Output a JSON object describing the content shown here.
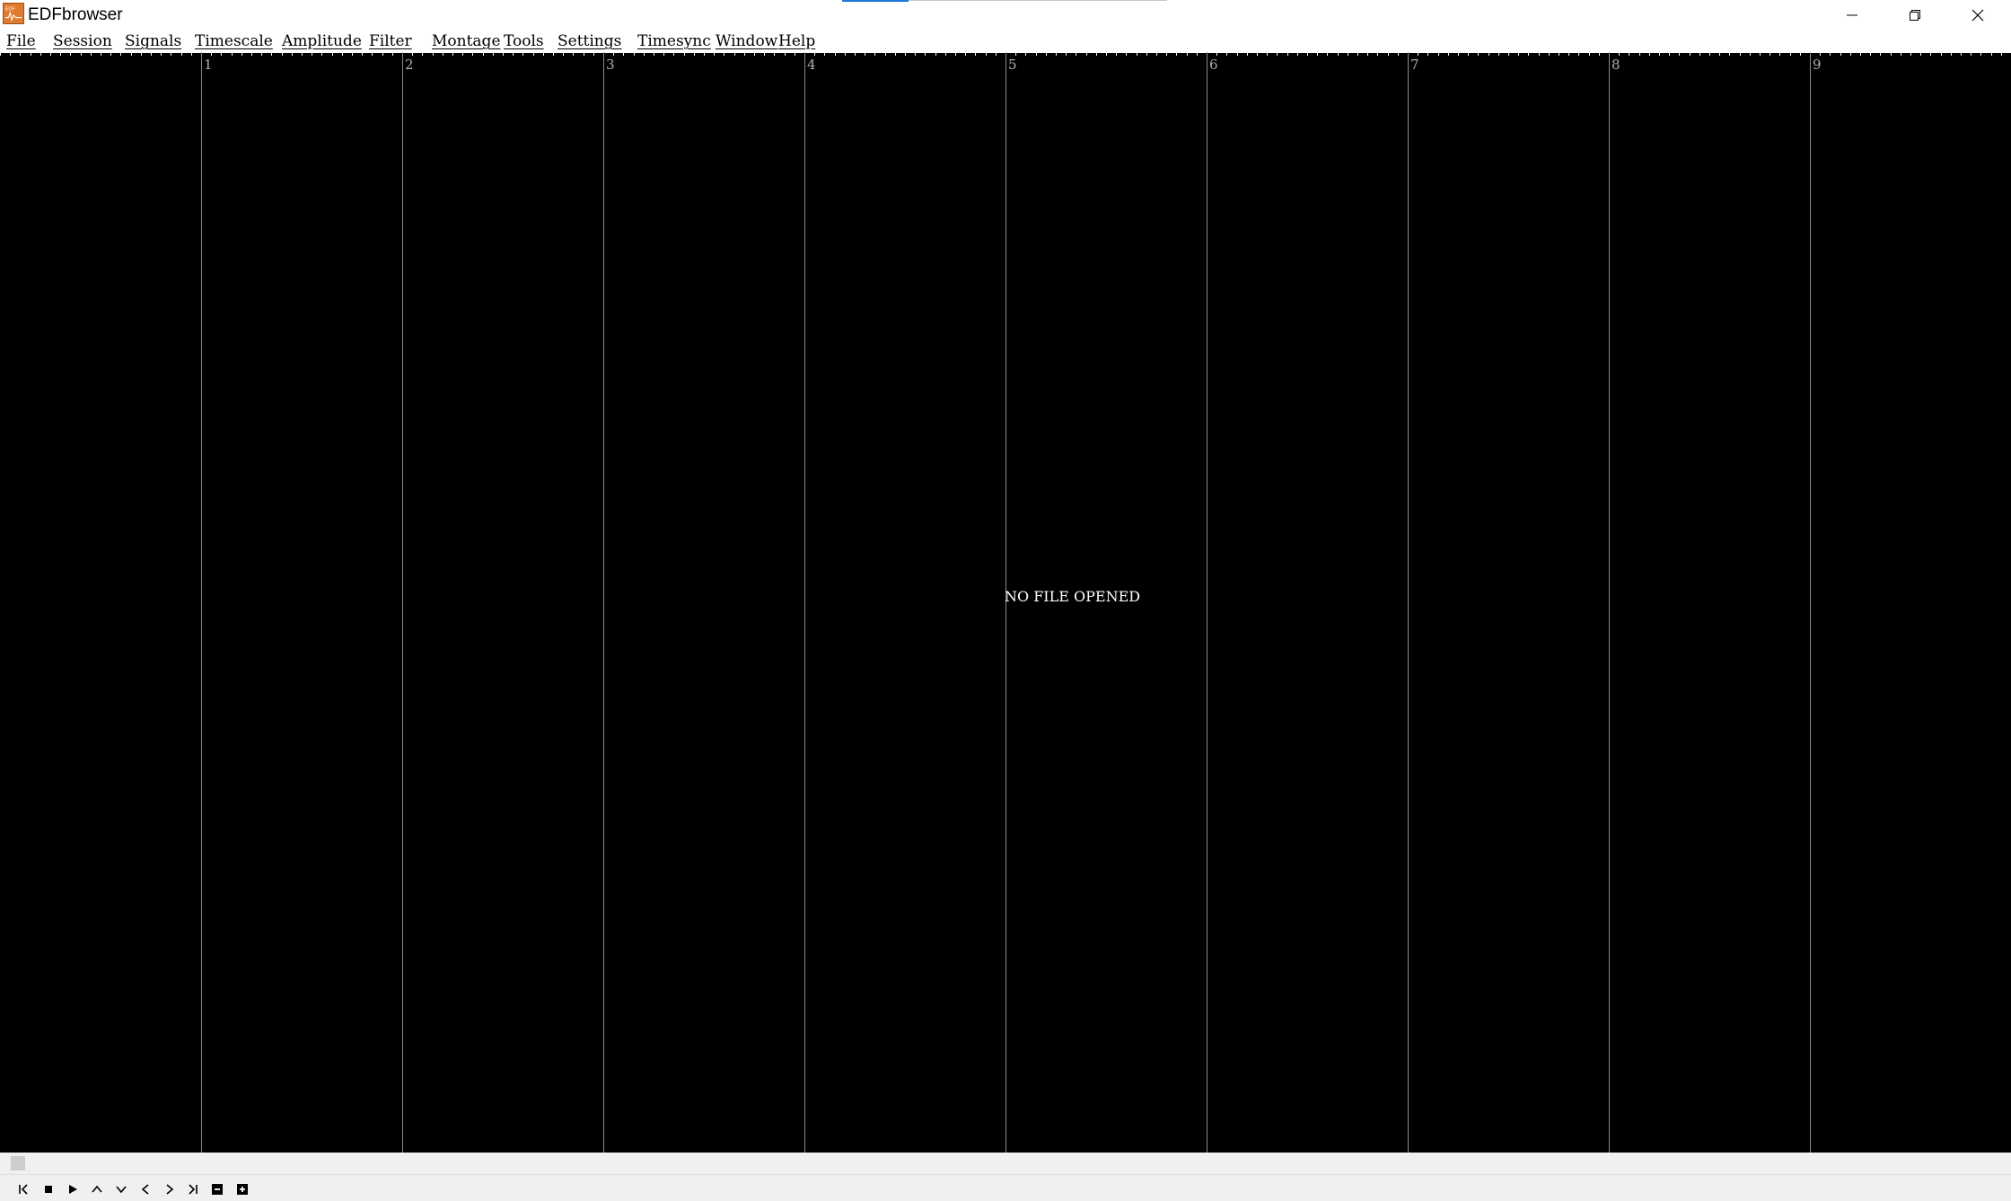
{
  "window": {
    "title": "EDFbrowser",
    "icons": {
      "app": "edfbrowser-logo-icon",
      "minimize": "minimize-icon",
      "restore": "restore-icon",
      "close": "close-icon"
    },
    "accent_color": "#1e78d7"
  },
  "menubar": {
    "items": [
      {
        "label": "File"
      },
      {
        "label": "Session"
      },
      {
        "label": "Signals"
      },
      {
        "label": "Timescale"
      },
      {
        "label": "Amplitude"
      },
      {
        "label": "Filter"
      },
      {
        "label": "Montage"
      },
      {
        "label": "Tools"
      },
      {
        "label": "Settings"
      },
      {
        "label": "Timesync"
      },
      {
        "label": "Window"
      },
      {
        "label": "Help"
      }
    ]
  },
  "signal_view": {
    "background": "#000000",
    "grid_labels": [
      "1",
      "2",
      "3",
      "4",
      "5",
      "6",
      "7",
      "8",
      "9"
    ],
    "message": "NO FILE OPENED"
  },
  "playback_toolbar": {
    "buttons": [
      {
        "icon": "skip-to-start-icon"
      },
      {
        "icon": "stop-icon"
      },
      {
        "icon": "play-icon"
      },
      {
        "icon": "chevron-up-icon"
      },
      {
        "icon": "chevron-down-icon"
      },
      {
        "icon": "chevron-left-icon"
      },
      {
        "icon": "chevron-right-icon"
      },
      {
        "icon": "skip-to-end-icon"
      },
      {
        "icon": "minus-icon"
      },
      {
        "icon": "plus-icon"
      }
    ]
  }
}
